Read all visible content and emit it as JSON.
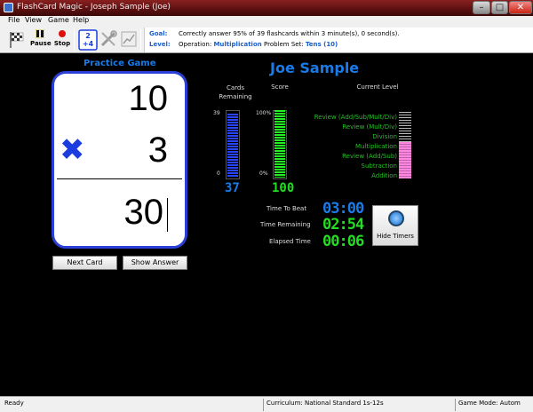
{
  "window": {
    "title": "FlashCard Magic - Joseph  Sample (Joe)",
    "min": "–",
    "max": "□",
    "close": "✕"
  },
  "menu": [
    "File",
    "View",
    "Game",
    "Help"
  ],
  "toolbar": {
    "pause": "Pause",
    "stop": "Stop"
  },
  "goal": {
    "goal_label": "Goal:",
    "goal_text": "Correctly answer 95% of 39 flashcards within 3 minute(s), 0 second(s).",
    "level_label": "Level:",
    "operation_label": "Operation:",
    "operation_value": "Multiplication",
    "problemset_label": "Problem Set:",
    "problemset_value": "Tens (10)"
  },
  "practice": {
    "title": "Practice Game",
    "top_number": "10",
    "operator": "✖",
    "bottom_number": "3",
    "answer": "30",
    "next_card": "Next Card",
    "show_answer": "Show Answer"
  },
  "player": "Joe Sample",
  "stats": {
    "cards_remaining_label": "Cards\nRemaining",
    "score_label": "Score",
    "current_level_label": "Current Level",
    "cards_axis_top": "39",
    "cards_axis_bottom": "0",
    "score_axis_top": "100%",
    "score_axis_bottom": "0%",
    "cards_value": "37",
    "score_value": "100",
    "cards_fraction": 0.95,
    "score_fraction": 1.0
  },
  "levels": [
    "Review (Add/Sub/Mult/Div)",
    "Review (Mult/Div)",
    "Division",
    "Multiplication",
    "Review (Add/Sub)",
    "Subtraction",
    "Addition"
  ],
  "timers": {
    "time_to_beat_label": "Time To Beat",
    "time_to_beat": "03:00",
    "time_remaining_label": "Time Remaining",
    "time_remaining": "02:54",
    "elapsed_label": "Elapsed Time",
    "elapsed": "00:06",
    "hide_timers": "Hide Timers"
  },
  "status": {
    "ready": "Ready",
    "curriculum": "Curriculum: National Standard 1s-12s",
    "game_mode": "Game Mode: Autom"
  },
  "colors": {
    "accent_blue": "#1a7be8",
    "green": "#22dd22",
    "pink": "#ff88dd"
  }
}
